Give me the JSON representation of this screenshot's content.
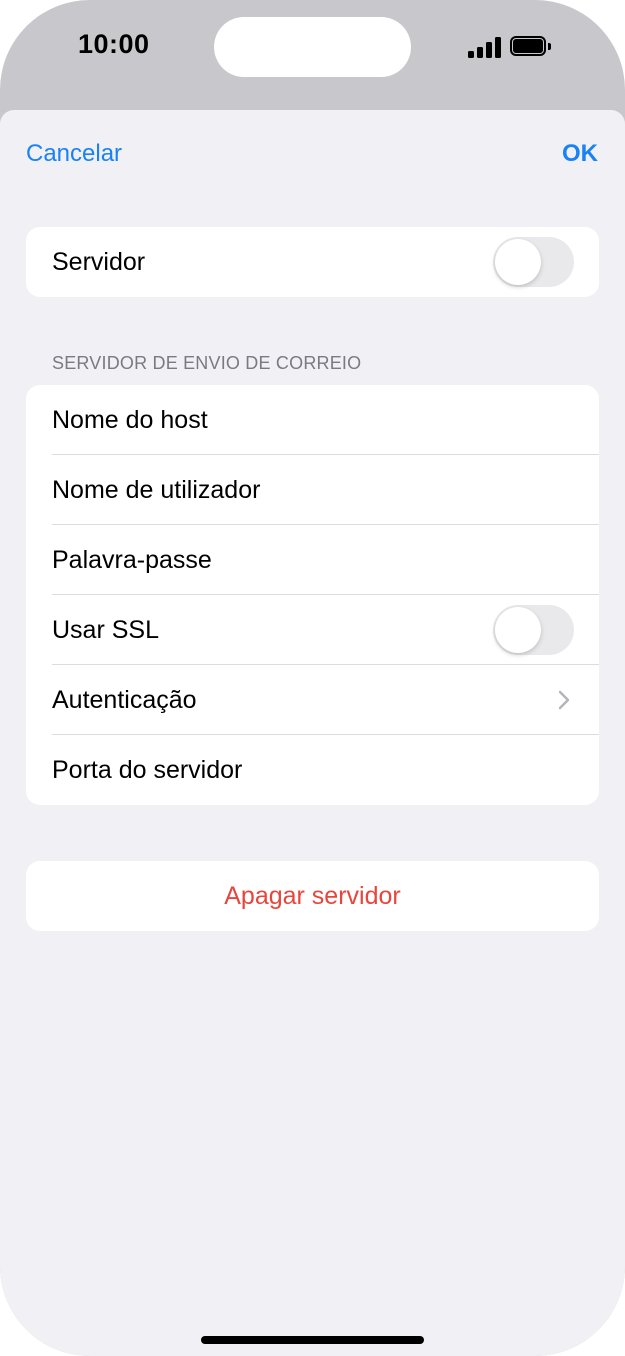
{
  "status_bar": {
    "time": "10:00",
    "signal_icon": "cellular-signal-icon",
    "battery_icon": "battery-icon",
    "battery_level": 1.0
  },
  "nav": {
    "cancel_label": "Cancelar",
    "ok_label": "OK"
  },
  "server_group": {
    "server_label": "Servidor",
    "server_enabled": false
  },
  "outgoing_section": {
    "header": "SERVIDOR DE ENVIO DE CORREIO",
    "rows": {
      "hostname": "Nome do host",
      "username": "Nome de utilizador",
      "password": "Palavra-passe",
      "use_ssl": "Usar SSL",
      "authentication": "Autenticação",
      "server_port": "Porta do servidor"
    },
    "use_ssl_enabled": false
  },
  "delete": {
    "label": "Apagar servidor"
  },
  "colors": {
    "accent": "#1a82f5",
    "destructive": "#e8453c",
    "sheet_background": "#f0f0f5",
    "toggle_off": "#e9e9eb"
  }
}
